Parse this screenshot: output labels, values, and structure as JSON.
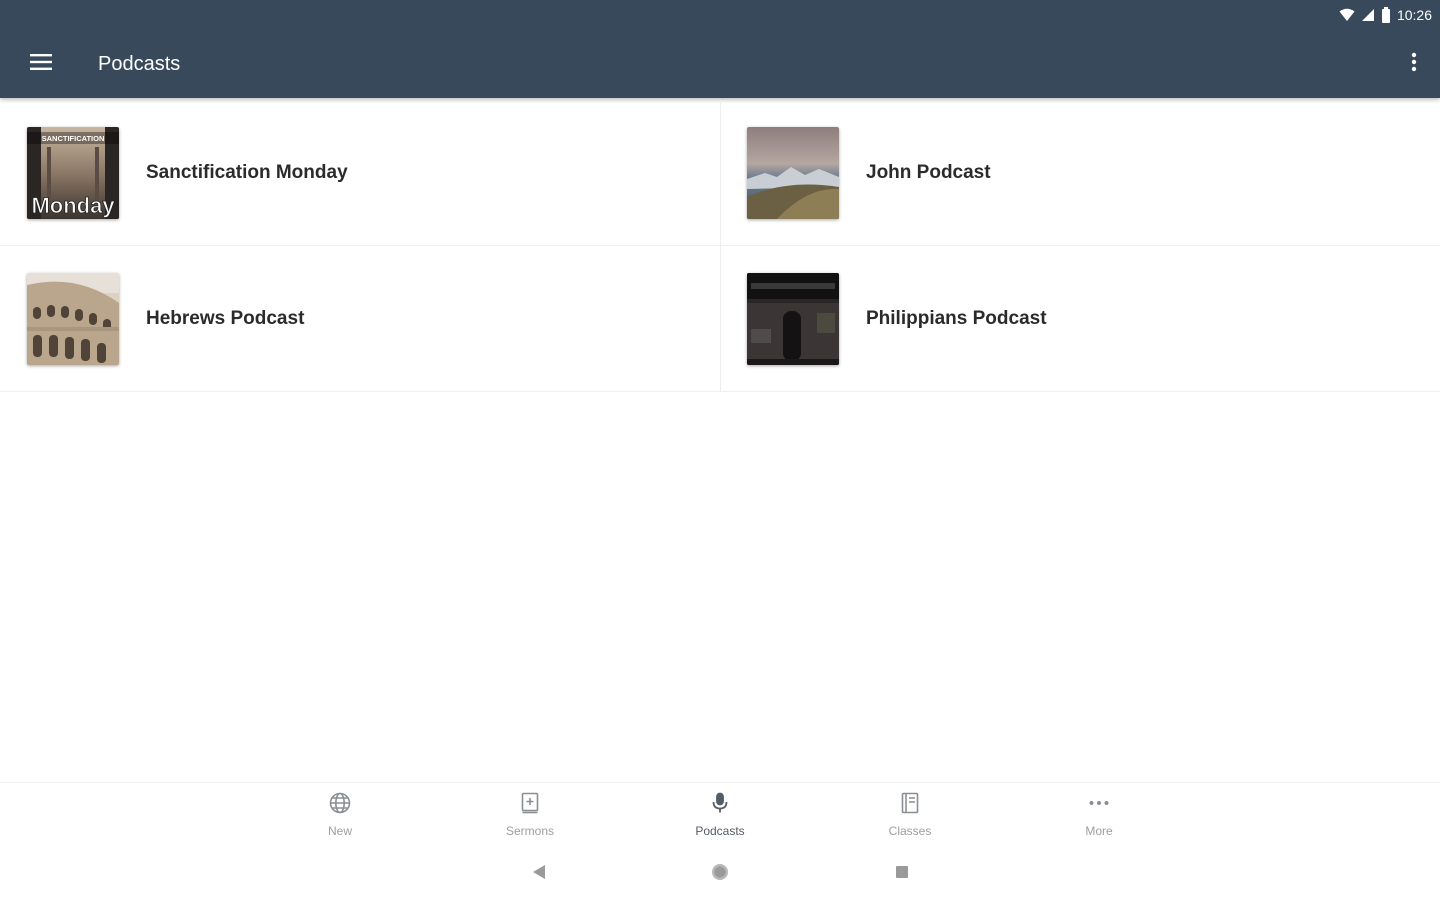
{
  "status": {
    "time": "10:26"
  },
  "appbar": {
    "title": "Podcasts"
  },
  "podcasts": [
    {
      "title": "Sanctification Monday",
      "thumb_text_top": "SANCTIFICATION",
      "thumb_text_main": "Monday"
    },
    {
      "title": "John Podcast"
    },
    {
      "title": "Hebrews Podcast"
    },
    {
      "title": "Philippians Podcast"
    }
  ],
  "bottom_nav": {
    "items": [
      {
        "label": "New",
        "icon": "globe-icon"
      },
      {
        "label": "Sermons",
        "icon": "book-plus-icon"
      },
      {
        "label": "Podcasts",
        "icon": "microphone-icon",
        "active": true
      },
      {
        "label": "Classes",
        "icon": "notebook-icon"
      },
      {
        "label": "More",
        "icon": "more-horizontal-icon"
      }
    ]
  },
  "colors": {
    "appbar": "#37495b",
    "active_nav": "#555d66",
    "inactive_nav": "#9e9e9e"
  }
}
